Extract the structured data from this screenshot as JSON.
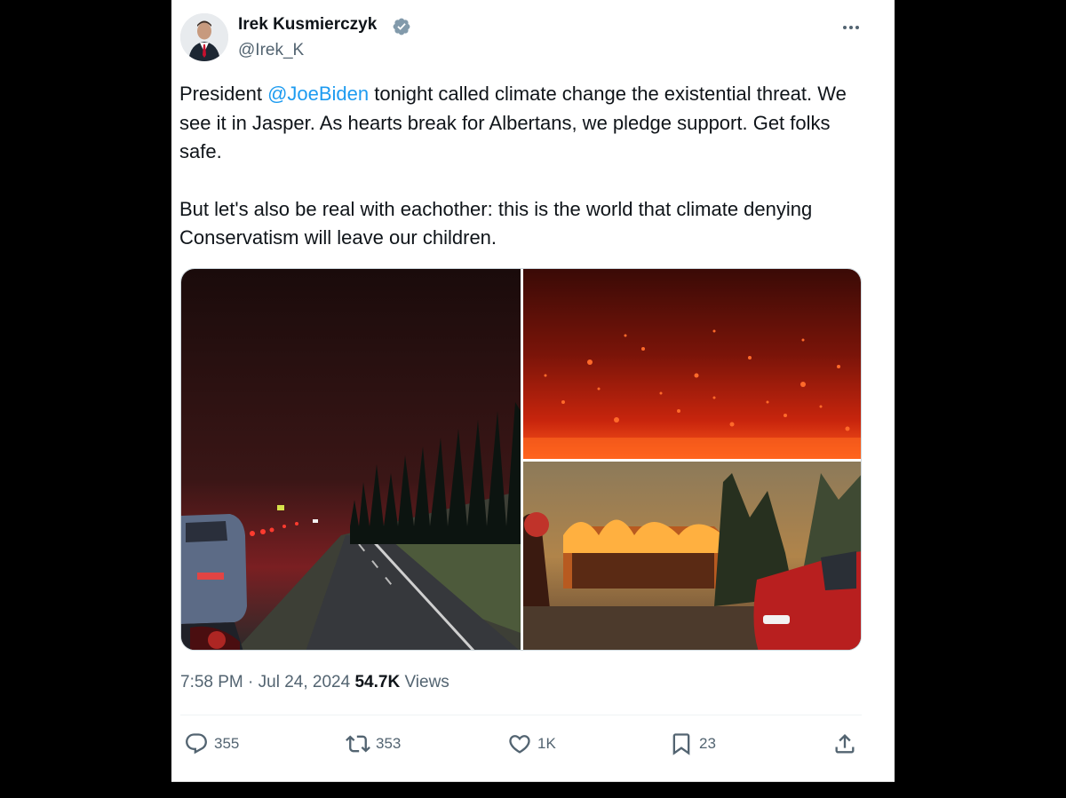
{
  "author": {
    "name": "Irek Kusmierczyk",
    "handle": "@Irek_K",
    "verified": true
  },
  "tweet": {
    "text_before_mention": "President ",
    "mention": "@JoeBiden",
    "text_after_mention": " tonight called climate change the existential threat. We see it in Jasper. As hearts break for Albertans, we pledge support. Get folks safe.",
    "paragraph_2": "But let's also be real with eachother: this is the world that climate denying Conservatism will leave our children."
  },
  "media": {
    "images": [
      "highway-night-traffic-photo",
      "wildfire-embers-forest-photo",
      "burning-building-firefighter-photo"
    ]
  },
  "meta": {
    "time": "7:58 PM",
    "separator": " · ",
    "date": "Jul 24, 2024",
    "views_count": "54.7K",
    "views_label": " Views"
  },
  "actions": {
    "replies": "355",
    "reposts": "353",
    "likes": "1K",
    "bookmarks": "23"
  },
  "colors": {
    "accent": "#1d9bf0",
    "secondary_text": "#536471",
    "primary_text": "#0f1419"
  }
}
